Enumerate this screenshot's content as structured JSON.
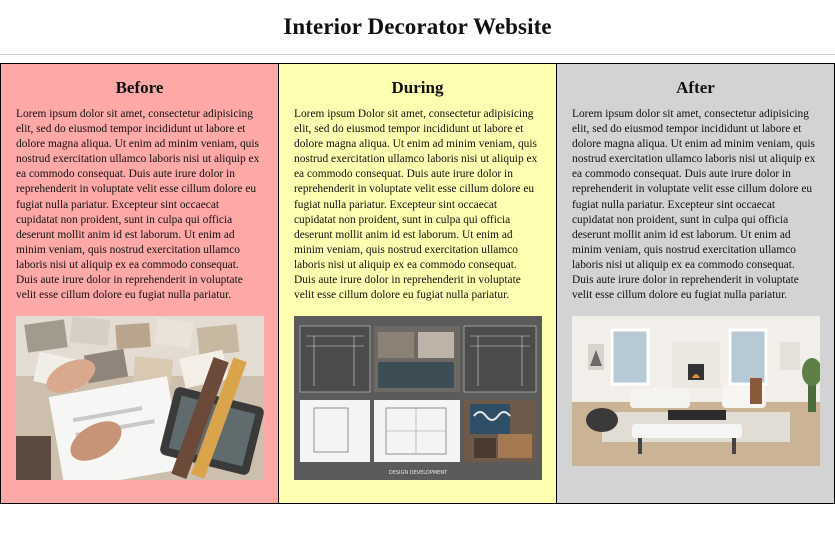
{
  "page": {
    "title": "Interior Decorator Website"
  },
  "columns": [
    {
      "heading": "Before",
      "text": "Lorem ipsum dolor sit amet, consectetur adipisicing elit, sed do eiusmod tempor incididunt ut labore et dolore magna aliqua. Ut enim ad minim veniam, quis nostrud exercitation ullamco laboris nisi ut aliquip ex ea commodo consequat. Duis aute irure dolor in reprehenderit in voluptate velit esse cillum dolore eu fugiat nulla pariatur. Excepteur sint occaecat cupidatat non proident, sunt in culpa qui officia deserunt mollit anim id est laborum. Ut enim ad minim veniam, quis nostrud exercitation ullamco laboris nisi ut aliquip ex ea commodo consequat. Duis aute irure dolor in reprehenderit in voluptate velit esse cillum dolore eu fugiat nulla pariatur.",
      "bg_color": "#ffa8a8",
      "image_icon": "material-swatches-photo"
    },
    {
      "heading": "During",
      "text": "Lorem ipsum Dolor sit amet, consectetur adipisicing elit, sed do eiusmod tempor incididunt ut labore et dolore magna aliqua. Ut enim ad minim veniam, quis nostrud exercitation ullamco laboris nisi ut aliquip ex ea commodo consequat. Duis aute irure dolor in reprehenderit in voluptate velit esse cillum dolore eu fugiat nulla pariatur. Excepteur sint occaecat cupidatat non proident, sunt in culpa qui officia deserunt mollit anim id est laborum. Ut enim ad minim veniam, quis nostrud exercitation ullamco laboris nisi ut aliquip ex ea commodo consequat. Duis aute irure dolor in reprehenderit in voluptate velit esse cillum dolore eu fugiat nulla pariatur.",
      "bg_color": "#ffffb2",
      "image_icon": "design-board-photo",
      "image_caption": "DESIGN DEVELOPMENT"
    },
    {
      "heading": "After",
      "text": "Lorem ipsum dolor sit amet, consectetur adipisicing elit, sed do eiusmod tempor incididunt ut labore et dolore magna aliqua. Ut enim ad minim veniam, quis nostrud exercitation ullamco laboris nisi ut aliquip ex ea commodo consequat. Duis aute irure dolor in reprehenderit in voluptate velit esse cillum dolore eu fugiat nulla pariatur. Excepteur sint occaecat cupidatat non proident, sunt in culpa qui officia deserunt mollit anim id est laborum. Ut enim ad minim veniam, quis nostrud exercitation ullamco laboris nisi ut aliquip ex ea commodo consequat. Duis aute irure dolor in reprehenderit in voluptate velit esse cillum dolore eu fugiat nulla pariatur.",
      "bg_color": "#d3d3d3",
      "image_icon": "finished-living-room-photo"
    }
  ]
}
